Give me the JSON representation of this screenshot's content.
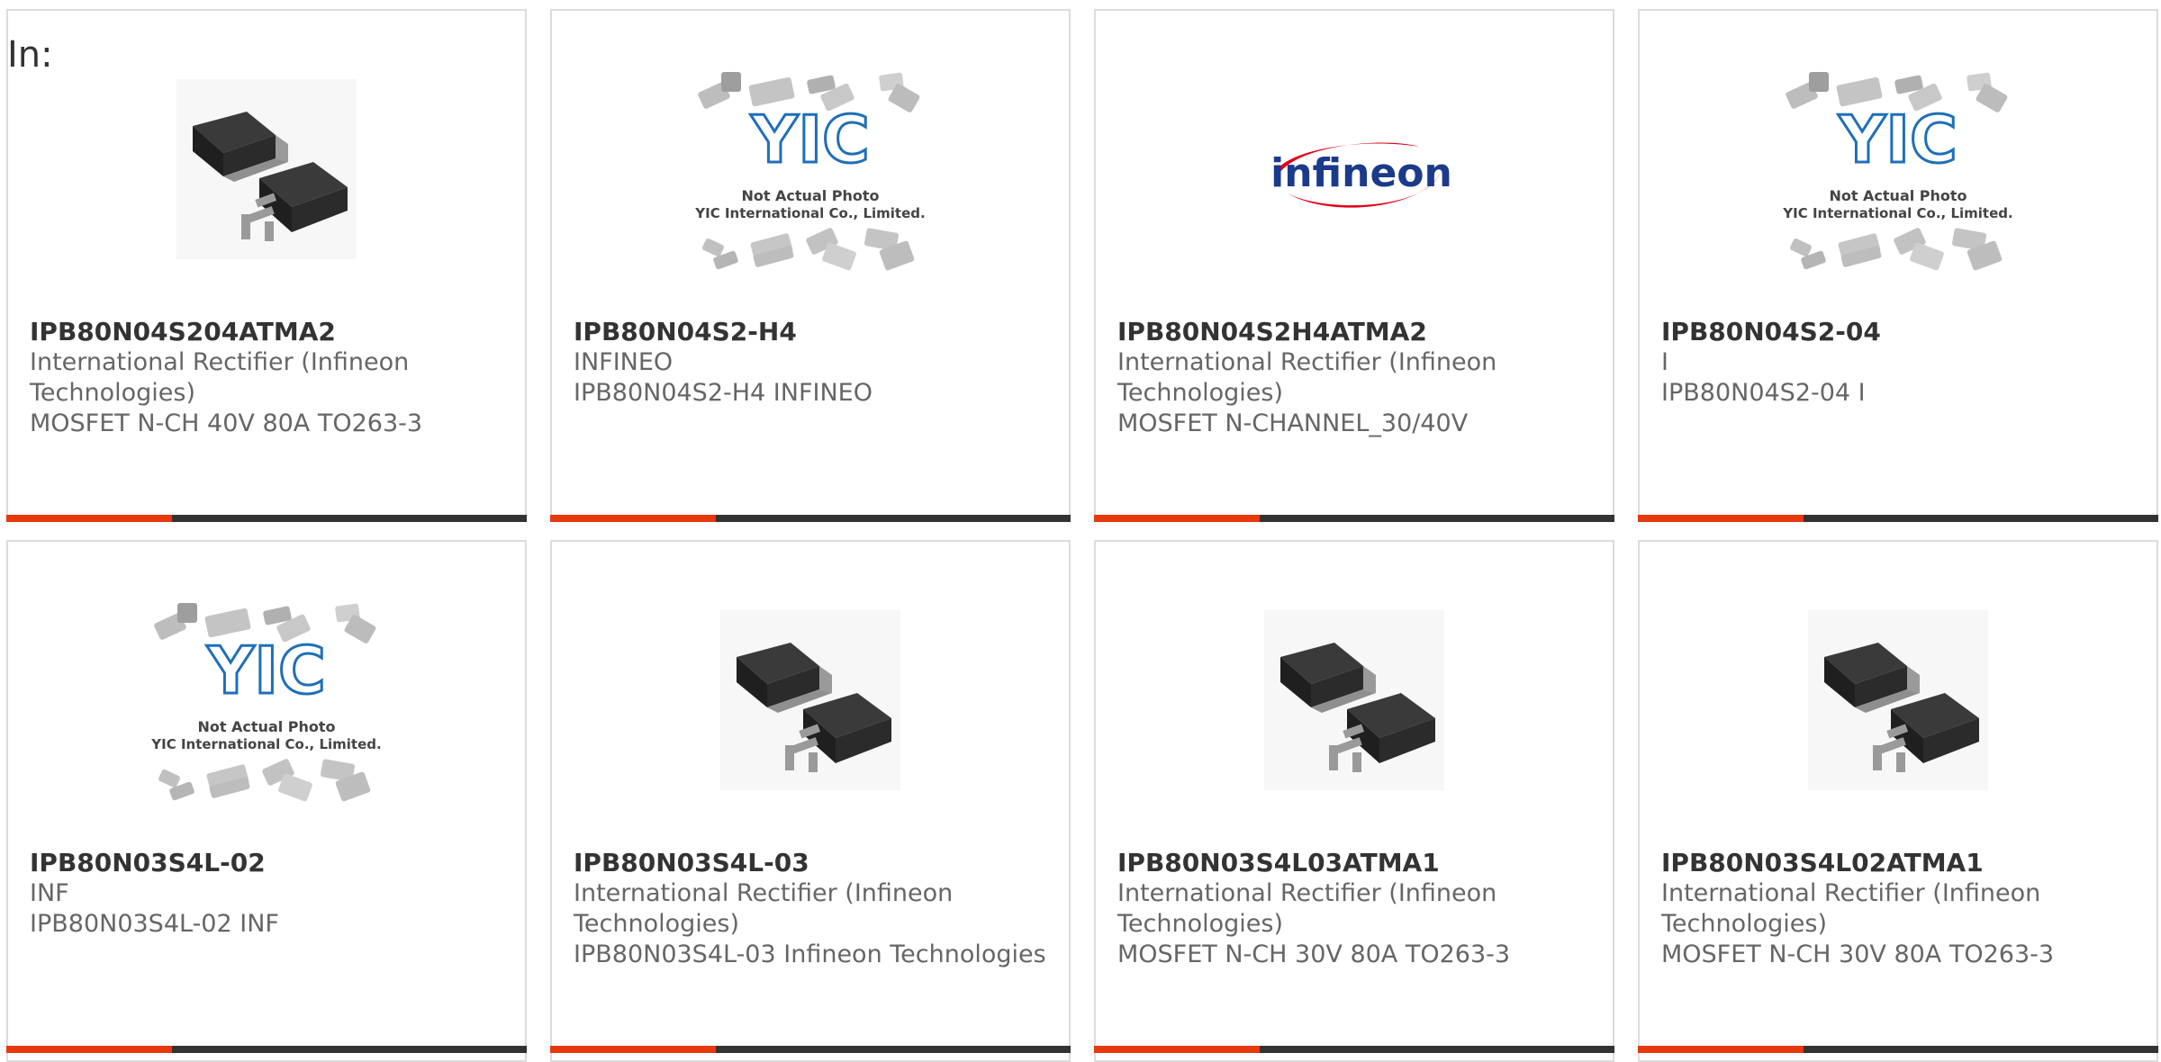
{
  "header": {
    "label": "In:"
  },
  "colors": {
    "accent": "#e8380d",
    "bar": "#333333"
  },
  "products": [
    {
      "part": "IPB80N04S204ATMA2",
      "manufacturer": "International Rectifier (Infineon Technologies)",
      "description": "MOSFET N-CH 40V 80A TO263-3",
      "image": "to263-package"
    },
    {
      "part": "IPB80N04S2-H4",
      "manufacturer": "INFINEO",
      "description": "IPB80N04S2-H4 INFINEO",
      "image": "yic-placeholder"
    },
    {
      "part": "IPB80N04S2H4ATMA2",
      "manufacturer": "International Rectifier (Infineon Technologies)",
      "description": "MOSFET N-CHANNEL_30/40V",
      "image": "infineon-logo"
    },
    {
      "part": "IPB80N04S2-04",
      "manufacturer": "I",
      "description": "IPB80N04S2-04 I",
      "image": "yic-placeholder"
    },
    {
      "part": "IPB80N03S4L-02",
      "manufacturer": "INF",
      "description": "IPB80N03S4L-02 INF",
      "image": "yic-placeholder"
    },
    {
      "part": "IPB80N03S4L-03",
      "manufacturer": "International Rectifier (Infineon Technologies)",
      "description": "IPB80N03S4L-03 Infineon Technologies",
      "image": "to263-package"
    },
    {
      "part": "IPB80N03S4L03ATMA1",
      "manufacturer": "International Rectifier (Infineon Technologies)",
      "description": "MOSFET N-CH 30V 80A TO263-3",
      "image": "to263-package"
    },
    {
      "part": "IPB80N03S4L02ATMA1",
      "manufacturer": "International Rectifier (Infineon Technologies)",
      "description": "MOSFET N-CH 30V 80A TO263-3",
      "image": "to263-package"
    }
  ],
  "placeholder": {
    "line1": "Not Actual Photo",
    "line2": "YIC International Co., Limited.",
    "logo": "YIC"
  },
  "brand_logo": {
    "text": "infineon"
  }
}
